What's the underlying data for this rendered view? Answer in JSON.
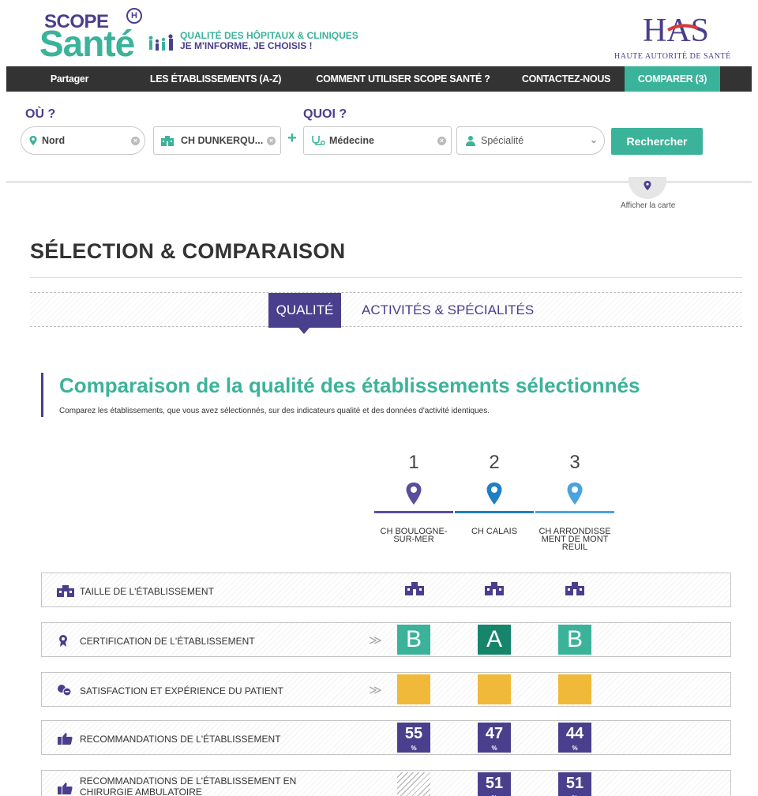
{
  "header": {
    "logo_scope": "SCOPE",
    "logo_sante": "Santé",
    "logo_h": "H",
    "tagline_1": "QUALITÉ DES HÔPITAUX & CLINIQUES",
    "tagline_2": "JE M'INFORME, JE CHOISIS !",
    "has_logo": "HAS",
    "has_sub": "HAUTE AUTORITÉ DE SANTÉ"
  },
  "nav": {
    "share": "Partager",
    "etablissements": "LES ÉTABLISSEMENTS (A-Z)",
    "comment": "COMMENT UTILISER SCOPE SANTÉ ?",
    "contact": "CONTACTEZ-NOUS",
    "compare": "COMPARER (3)"
  },
  "search": {
    "where_label": "OÙ ?",
    "what_label": "QUOI ?",
    "location": "Nord",
    "establishment": "CH DUNKERQU...",
    "category": "Médecine",
    "specialty_placeholder": "Spécialité",
    "button": "Rechercher"
  },
  "map_toggle": "Afficher la carte",
  "page_title": "SÉLECTION & COMPARAISON",
  "tabs": {
    "quality": "QUALITÉ",
    "activities": "ACTIVITÉS & SPÉCIALITÉS"
  },
  "section": {
    "title": "Comparaison de la qualité des établissements sélectionnés",
    "subtitle": "Comparez les établissements, que vous avez sélectionnés, sur des indicateurs qualité et des données d'activité identiques."
  },
  "columns": [
    {
      "num": "1",
      "name": "CH BOULOGNE-SUR-MER",
      "color": "#5a4d9c"
    },
    {
      "num": "2",
      "name": "CH CALAIS",
      "color": "#1e7fc4"
    },
    {
      "num": "3",
      "name": "CH ARRONDISSEMENT DE MONTREUIL",
      "color": "#4aa3e0"
    }
  ],
  "rows": {
    "taille": "TAILLE DE L'ÉTABLISSEMENT",
    "certification": "CERTIFICATION DE L'ÉTABLISSEMENT",
    "satisfaction": "SATISFACTION ET EXPÉRIENCE DU PATIENT",
    "recommandations": "RECOMMANDATIONS DE L'ÉTABLISSEMENT",
    "recommandations_ambu": "RECOMMANDATIONS DE L'ÉTABLISSEMENT EN CHIRURGIE AMBULATOIRE"
  },
  "more_glyph": "≫",
  "certification": [
    "B",
    "A",
    "B"
  ],
  "certification_colors": {
    "A": "#16856b",
    "B": "#3bb39a"
  },
  "satisfaction_color": "#f0b93a",
  "recommandations": [
    "55",
    "47",
    "44"
  ],
  "recommandations_ambu": [
    "",
    "51",
    "51"
  ],
  "percent": "%"
}
